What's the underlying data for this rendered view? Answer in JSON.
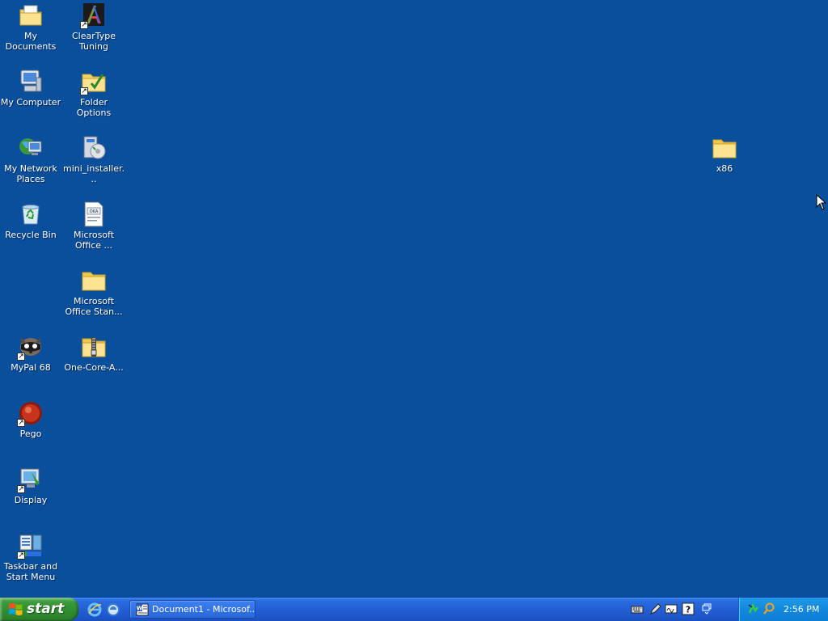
{
  "desktop": {
    "background_color": "#0a4f9c",
    "icons": [
      {
        "id": "my-documents",
        "label": "My Documents",
        "icon": "my-documents-icon",
        "shortcut": false
      },
      {
        "id": "cleartype-tuning",
        "label": "ClearType Tuning",
        "icon": "cleartype-icon",
        "shortcut": true
      },
      {
        "id": "my-computer",
        "label": "My Computer",
        "icon": "my-computer-icon",
        "shortcut": false
      },
      {
        "id": "folder-options",
        "label": "Folder Options",
        "icon": "folder-options-icon",
        "shortcut": true
      },
      {
        "id": "my-network-places",
        "label": "My Network Places",
        "icon": "network-places-icon",
        "shortcut": false
      },
      {
        "id": "mini-installer",
        "label": "mini_installer...",
        "icon": "installer-icon",
        "shortcut": false
      },
      {
        "id": "recycle-bin",
        "label": "Recycle Bin",
        "icon": "recycle-bin-icon",
        "shortcut": false
      },
      {
        "id": "microsoft-office-1",
        "label": "Microsoft Office ...",
        "icon": "document-icon",
        "shortcut": false
      },
      {
        "id": "microsoft-office-standard",
        "label": "Microsoft Office Stan...",
        "icon": "folder-icon",
        "shortcut": false
      },
      {
        "id": "mypal-68",
        "label": "MyPal 68",
        "icon": "mypal-icon",
        "shortcut": true
      },
      {
        "id": "one-core-api",
        "label": "One-Core-A...",
        "icon": "zip-folder-icon",
        "shortcut": false
      },
      {
        "id": "pego",
        "label": "Pego",
        "icon": "pego-icon",
        "shortcut": true
      },
      {
        "id": "display",
        "label": "Display",
        "icon": "display-icon",
        "shortcut": true
      },
      {
        "id": "taskbar-start-menu",
        "label": "Taskbar and Start Menu",
        "icon": "taskbar-icon",
        "shortcut": true
      },
      {
        "id": "x86",
        "label": "x86",
        "icon": "folder-icon",
        "shortcut": false
      }
    ]
  },
  "taskbar": {
    "start_label": "start",
    "quick_launch": [
      {
        "id": "ie",
        "icon": "internet-explorer-icon"
      },
      {
        "id": "browser2",
        "icon": "browser-icon"
      }
    ],
    "tasks": [
      {
        "id": "document1",
        "label": "Document1 - Microsof...",
        "icon": "word-document-icon"
      }
    ],
    "language_bar": [
      "keyboard-icon",
      "pen-icon",
      "handwriting-icon",
      "help-icon",
      "restore-icon"
    ],
    "tray": {
      "icons": [
        "network-icon",
        "search-icon"
      ],
      "clock": "2:56 PM"
    }
  }
}
